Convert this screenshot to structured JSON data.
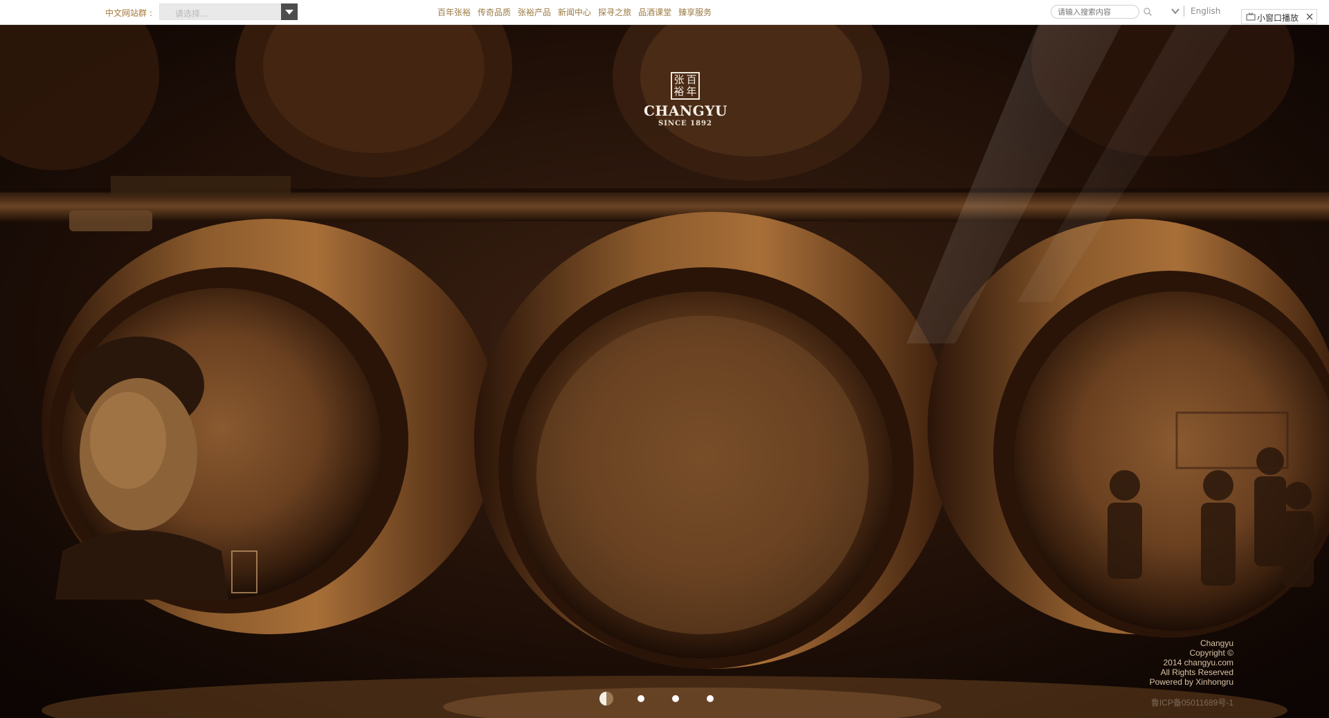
{
  "header": {
    "site_group_label": "中文网站群 :",
    "site_select_placeholder": "请选择...",
    "nav": [
      "百年张裕",
      "传奇品质",
      "张裕产品",
      "新闻中心",
      "探寻之旅",
      "品酒课堂",
      "臻享服务"
    ],
    "search_placeholder": "请输入搜索内容",
    "language_link": "English",
    "mini_player_label": "小窗口播放"
  },
  "logo": {
    "seal_chars": [
      "张",
      "百",
      "裕",
      "年"
    ],
    "wordmark": "CHANGYU",
    "since": "SINCE 1892"
  },
  "footer": {
    "lines": [
      "Changyu",
      "Copyright ©",
      "2014 changyu.com",
      "All Rights Reserved",
      "Powered by Xinhongru"
    ],
    "icp": "鲁ICP备05011689号-1"
  },
  "carousel": {
    "slide_count": 4,
    "active_index": 0
  },
  "colors": {
    "nav_text": "#9b7a43",
    "label_text": "#a5793b",
    "hero_dark": "#1a0d06",
    "barrel_wood": "#7a4a22"
  }
}
